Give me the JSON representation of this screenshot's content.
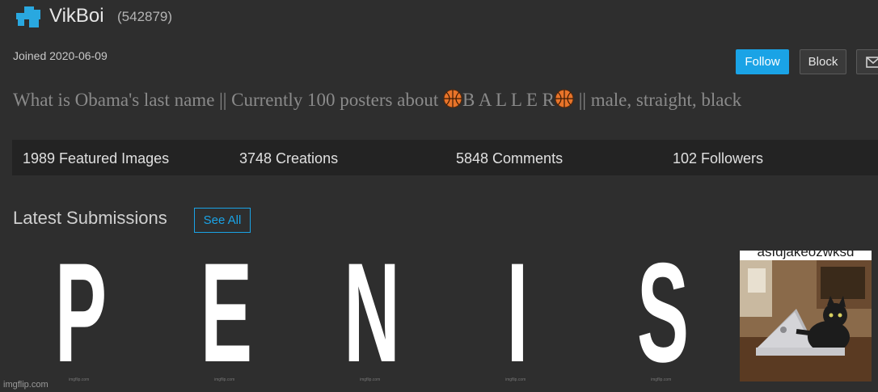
{
  "profile": {
    "username": "VikBoi",
    "user_id": "(542879)",
    "joined": "Joined 2020-06-09",
    "bio_parts": [
      "What is Obama's last name || Currently 100 posters about ",
      "B A L L E R",
      " || male, straight, black"
    ]
  },
  "actions": {
    "follow_label": "Follow",
    "block_label": "Block"
  },
  "stats": [
    "1989 Featured Images",
    "3748 Creations",
    "5848 Comments",
    "102 Followers"
  ],
  "submissions": {
    "title": "Latest Submissions",
    "see_all_label": "See All",
    "letters": [
      "P",
      "E",
      "N",
      "I",
      "S"
    ],
    "thumb_watermark": "imgflip.com",
    "last_caption": "asfdjakeozwksd"
  },
  "footer": {
    "watermark": "imgflip.com"
  },
  "colors": {
    "background": "#2e2e2e",
    "accent": "#1aa3e6",
    "stats_bar": "#232323"
  },
  "icons": [
    "user-avatar-icon",
    "mail-icon",
    "basketball-icon"
  ]
}
